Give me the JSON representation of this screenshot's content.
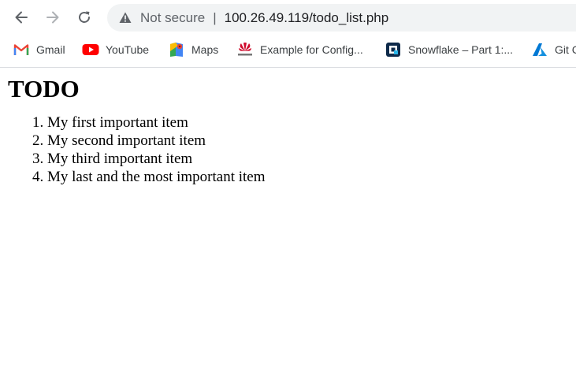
{
  "browser": {
    "address_bar": {
      "security_label": "Not secure",
      "divider": "|",
      "url": "100.26.49.119/todo_list.php"
    },
    "bookmarks": [
      {
        "label": "Gmail",
        "icon": "gmail-icon"
      },
      {
        "label": "YouTube",
        "icon": "youtube-icon"
      },
      {
        "label": "Maps",
        "icon": "maps-icon"
      },
      {
        "label": "Example for Config...",
        "icon": "huawei-icon"
      },
      {
        "label": "Snowflake – Part 1:...",
        "icon": "snowflake-icon"
      },
      {
        "label": "Git C",
        "icon": "azure-icon"
      }
    ],
    "colors": {
      "omnibox_bg": "#f1f3f4",
      "icon_gray": "#5f6368",
      "youtube_red": "#ff0000",
      "gmail_red": "#ea4335",
      "azure_blue": "#0078d4"
    }
  },
  "page": {
    "title": "TODO",
    "items": [
      "My first important item",
      "My second important item",
      "My third important item",
      "My last and the most important item"
    ]
  }
}
